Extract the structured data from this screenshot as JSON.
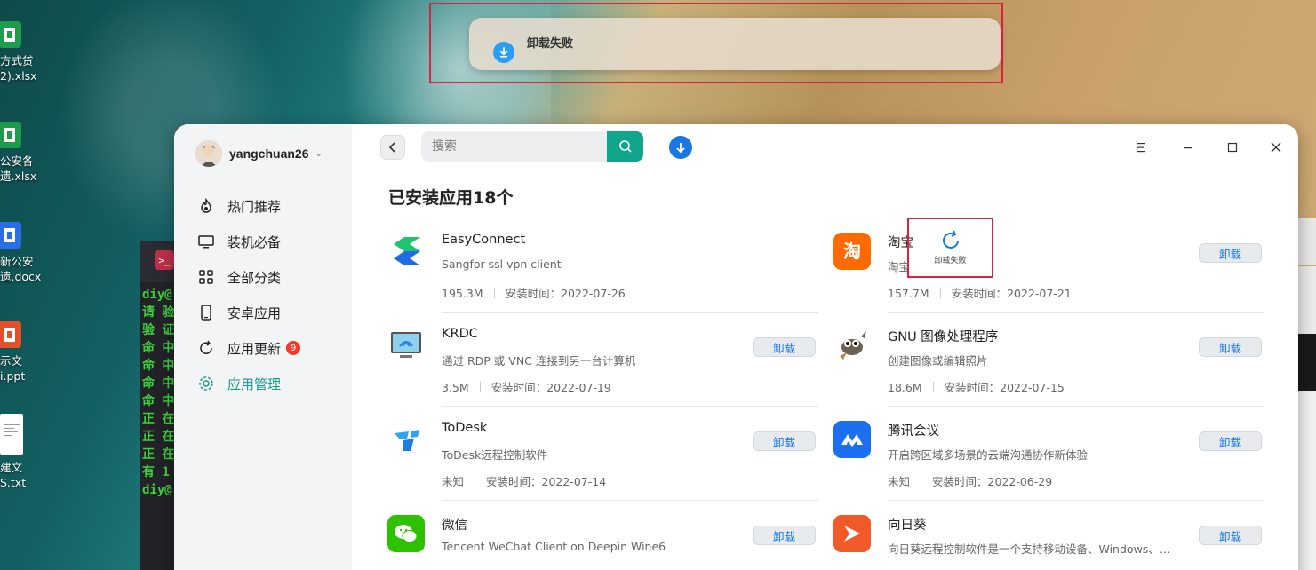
{
  "desktop": {
    "icons": [
      {
        "label_line1": "方式贷",
        "label_line2": "2).xlsx",
        "type": "xlsx"
      },
      {
        "label_line1": "公安各",
        "label_line2": "遗.xlsx",
        "type": "xlsx"
      },
      {
        "label_line1": "新公安",
        "label_line2": "遗.docx",
        "type": "docx"
      },
      {
        "label_line1": "示文",
        "label_line2": "i.ppt",
        "type": "ppt"
      },
      {
        "label_line1": "建文",
        "label_line2": "S.txt",
        "type": "txt"
      }
    ],
    "terminal": {
      "lines": [
        "diy@",
        "请 验",
        "验 证",
        "命 中",
        "命 中",
        "命 中",
        "命 中",
        "正 在",
        "正 在",
        "正 在",
        "有  1",
        "diy@"
      ]
    }
  },
  "notification": {
    "text": "卸载失败",
    "icon": "download-icon"
  },
  "sidebar": {
    "username": "yangchuan26",
    "items": [
      {
        "label": "热门推荐",
        "icon": "fire-icon",
        "active": false
      },
      {
        "label": "装机必备",
        "icon": "monitor-icon",
        "active": false
      },
      {
        "label": "全部分类",
        "icon": "grid-icon",
        "active": false
      },
      {
        "label": "安卓应用",
        "icon": "phone-icon",
        "active": false
      },
      {
        "label": "应用更新",
        "icon": "refresh-icon",
        "active": false,
        "badge": "9"
      },
      {
        "label": "应用管理",
        "icon": "gear-icon",
        "active": true
      }
    ]
  },
  "toolbar": {
    "search_placeholder": "搜索"
  },
  "main": {
    "title": "已安装应用18个",
    "uninstall_label": "卸载",
    "retry_label": "卸载失败",
    "meta_install_prefix": "安装时间：",
    "apps": [
      {
        "name": "EasyConnect",
        "desc": "Sangfor ssl vpn client",
        "size": "195.3M",
        "date": "2022-07-26",
        "status": "failed"
      },
      {
        "name": "淘宝",
        "desc": "淘宝",
        "size": "157.7M",
        "date": "2022-07-21",
        "status": "installed"
      },
      {
        "name": "KRDC",
        "desc": "通过 RDP 或 VNC 连接到另一台计算机",
        "size": "3.5M",
        "date": "2022-07-19",
        "status": "installed"
      },
      {
        "name": "GNU 图像处理程序",
        "desc": "创建图像或编辑照片",
        "size": "18.6M",
        "date": "2022-07-15",
        "status": "installed"
      },
      {
        "name": "ToDesk",
        "desc": "ToDesk远程控制软件",
        "size": "未知",
        "date": "2022-07-14",
        "status": "installed"
      },
      {
        "name": "腾讯会议",
        "desc": "开启跨区域多场景的云端沟通协作新体验",
        "size": "未知",
        "date": "2022-06-29",
        "status": "installed"
      },
      {
        "name": "微信",
        "desc": "Tencent WeChat Client on Deepin Wine6",
        "size": "",
        "date": "",
        "status": "installed"
      },
      {
        "name": "向日葵",
        "desc": "向日葵远程控制软件是一个支持移动设备、Windows、M…",
        "size": "",
        "date": "",
        "status": "installed"
      }
    ]
  },
  "colors": {
    "accent": "#1a9b8c",
    "search_btn": "#10a58c",
    "link_blue": "#1877e5",
    "badge_red": "#f33a2a",
    "highlight_red": "#e02040"
  }
}
